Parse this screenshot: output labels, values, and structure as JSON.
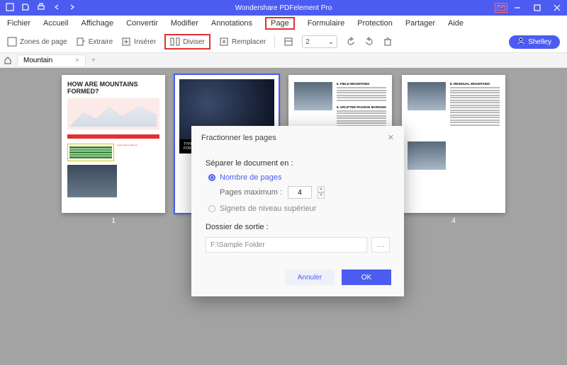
{
  "titlebar": {
    "title": "Wondershare PDFelement Pro"
  },
  "menu": {
    "items": [
      "Fichier",
      "Accueil",
      "Affichage",
      "Convertir",
      "Modifier",
      "Annotations",
      "Page",
      "Formulaire",
      "Protection",
      "Partager",
      "Aide"
    ],
    "highlighted_index": 6
  },
  "toolbar": {
    "zones": "Zones de page",
    "extract": "Extraire",
    "insert": "Insérer",
    "split": "Diviser",
    "replace": "Remplacer",
    "page_select_value": "2",
    "user": "Shelley"
  },
  "tabs": {
    "active": "Mountain"
  },
  "thumbs": {
    "t1_heading": "HOW ARE MOUNTAINS FORMED?",
    "t2_caption": "TYPE OF MOUNTAINS AND HOW ARE THEY FORMED",
    "t3_h1": "5. FIELD MOUNTAINS",
    "t3_h2": "6. UPLIFTED PASSIVE MARGINS",
    "t4_h1": "8. RESIDUAL MOUNTAINS",
    "labels": [
      "1",
      "",
      "",
      "4"
    ]
  },
  "dialog": {
    "title": "Fractionner les pages",
    "separate_label": "Séparer le document en :",
    "pages_option": "Nombre de pages",
    "pages_max_label": "Pages maximum :",
    "pages_max_value": "4",
    "bookmarks_option": "Signets de niveau supérieur",
    "output_label": "Dossier de sortie :",
    "output_path": "F:\\Sample Folder",
    "cancel": "Annuler",
    "ok": "OK"
  }
}
